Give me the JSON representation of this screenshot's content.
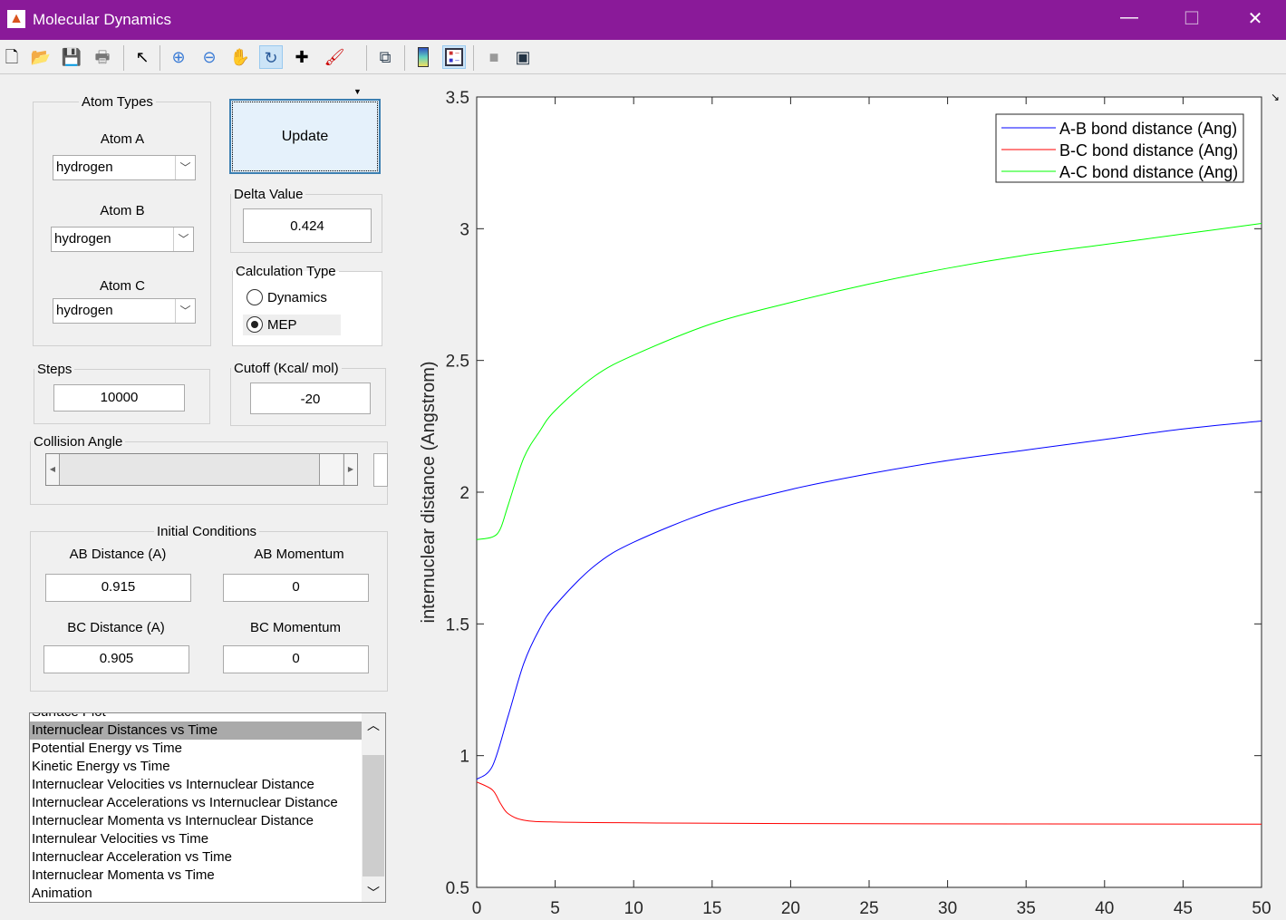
{
  "window": {
    "title": "Molecular Dynamics",
    "minimize": "—",
    "maximize": "☐",
    "close": "✕"
  },
  "toolbar": [
    "new-file",
    "open-folder",
    "save",
    "print",
    "pointer",
    "zoom-in",
    "zoom-out",
    "pan-hand",
    "rotate-3d",
    "data-cursor",
    "brush",
    "link-plot",
    "colorbar",
    "legend",
    "hide-plot-tools",
    "show-plot-tools"
  ],
  "atom_types": {
    "legend": "Atom Types",
    "atom_a_label": "Atom A",
    "atom_a": "hydrogen",
    "atom_b_label": "Atom B",
    "atom_b": "hydrogen",
    "atom_c_label": "Atom C",
    "atom_c": "hydrogen"
  },
  "update_label": "Update",
  "delta": {
    "legend": "Delta Value",
    "value": "0.424"
  },
  "calc": {
    "legend": "Calculation Type",
    "dynamics": "Dynamics",
    "mep": "MEP",
    "selected": "MEP"
  },
  "steps": {
    "legend": "Steps",
    "value": "10000"
  },
  "cutoff": {
    "legend": "Cutoff (Kcal/ mol)",
    "value": "-20"
  },
  "collision": {
    "legend": "Collision Angle",
    "slider_fraction": 1.0
  },
  "initial": {
    "legend": "Initial Conditions",
    "ab_dist_label": "AB Distance (A)",
    "ab_dist": "0.915",
    "ab_mom_label": "AB Momentum",
    "ab_mom": "0",
    "bc_dist_label": "BC Distance (A)",
    "bc_dist": "0.905",
    "bc_mom_label": "BC Momentum",
    "bc_mom": "0"
  },
  "plot_list": {
    "selected": 1,
    "items": [
      "Surface Plot",
      "Internuclear Distances vs Time",
      "Potential Energy vs Time",
      "Kinetic Energy vs Time",
      "Internuclear Velocities vs Internuclear Distance",
      "Internuclear Accelerations vs Internuclear Distance",
      "Internuclear Momenta vs Internuclear Distance",
      "Internulear Velocities vs Time",
      "Internuclear Acceleration vs Time",
      "Internuclear Momenta vs Time",
      "Animation"
    ]
  },
  "chart_data": {
    "type": "line",
    "ylabel": "internuclear distance (Angstrom)",
    "xlabel": "",
    "xlim": [
      0,
      50
    ],
    "ylim": [
      0.5,
      3.5
    ],
    "xticks": [
      "0",
      "5",
      "10",
      "15",
      "20",
      "25",
      "30",
      "35",
      "40",
      "45",
      "50"
    ],
    "yticks": [
      "0.5",
      "1",
      "1.5",
      "2",
      "2.5",
      "3",
      "3.5"
    ],
    "legend_position": "top-right",
    "grid": false,
    "series": [
      {
        "name": "A-B bond distance (Ang)",
        "color": "#0000ff",
        "x": [
          0,
          1,
          2,
          3,
          4,
          5,
          7.5,
          10,
          15,
          20,
          25,
          30,
          35,
          40,
          45,
          50
        ],
        "y": [
          0.91,
          0.96,
          1.15,
          1.35,
          1.48,
          1.57,
          1.72,
          1.81,
          1.93,
          2.01,
          2.07,
          2.12,
          2.16,
          2.2,
          2.24,
          2.27
        ]
      },
      {
        "name": "B-C bond distance (Ang)",
        "color": "#ff0000",
        "x": [
          0,
          1,
          1.5,
          2,
          3,
          5,
          10,
          20,
          50
        ],
        "y": [
          0.9,
          0.87,
          0.82,
          0.78,
          0.755,
          0.748,
          0.745,
          0.742,
          0.74
        ]
      },
      {
        "name": "A-C bond distance (Ang)",
        "color": "#00ff00",
        "x": [
          0,
          1,
          1.5,
          2,
          3,
          4,
          5,
          7.5,
          10,
          15,
          20,
          25,
          30,
          35,
          40,
          45,
          50
        ],
        "y": [
          1.82,
          1.83,
          1.86,
          1.95,
          2.13,
          2.23,
          2.31,
          2.44,
          2.52,
          2.64,
          2.72,
          2.79,
          2.85,
          2.9,
          2.94,
          2.98,
          3.02
        ]
      }
    ]
  }
}
